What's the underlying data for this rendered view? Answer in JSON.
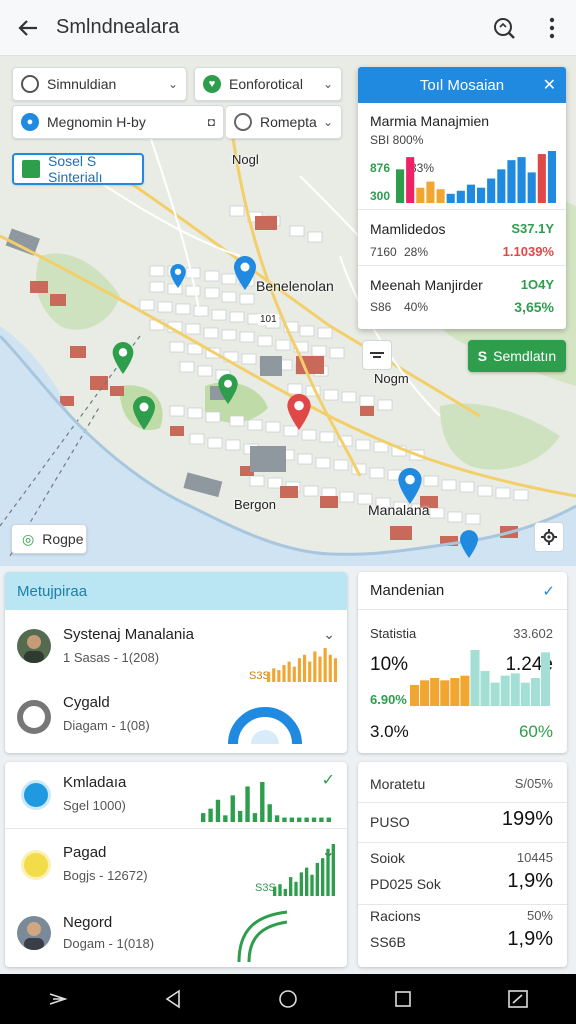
{
  "app": {
    "title": "Smlndnealara"
  },
  "map": {
    "filters": [
      {
        "label": "Simnuldian",
        "icon": "globe-icon"
      },
      {
        "label": "Eonforotical",
        "icon": "heart-icon"
      },
      {
        "label": "Megnomin H-by",
        "icon": "pin-icon"
      },
      {
        "label": "Romepta",
        "icon": "circle-icon"
      }
    ],
    "sidebar_chip": "Sosel S Sinterialı",
    "labels": {
      "nogl": "Nogl",
      "central": "Benelenolan",
      "nogm": "Nogm",
      "bergon": "Bergon",
      "manalana": "Manalana",
      "poi": "101"
    },
    "page_chip": "Rogpe",
    "action_button": "Semdlatın",
    "action_icon": "S"
  },
  "overlay": {
    "title": "Toıl Mosaian",
    "sections": [
      {
        "title": "Marmia Manajmien",
        "l1": "SBI 800%",
        "l2": "876",
        "l2b": "33%",
        "l3": "300",
        "bars": [
          {
            "v": 22,
            "c": "#2e9e4c"
          },
          {
            "v": 30,
            "c": "#e26"
          },
          {
            "v": 10,
            "c": "#f0a630"
          },
          {
            "v": 14,
            "c": "#f0a630"
          },
          {
            "v": 9,
            "c": "#f0a630"
          },
          {
            "v": 6,
            "c": "#1f8ae0"
          },
          {
            "v": 8,
            "c": "#1f8ae0"
          },
          {
            "v": 12,
            "c": "#1f8ae0"
          },
          {
            "v": 10,
            "c": "#1f8ae0"
          },
          {
            "v": 16,
            "c": "#1f8ae0"
          },
          {
            "v": 22,
            "c": "#1f8ae0"
          },
          {
            "v": 28,
            "c": "#1f8ae0"
          },
          {
            "v": 30,
            "c": "#1f8ae0"
          },
          {
            "v": 20,
            "c": "#1f8ae0"
          },
          {
            "v": 32,
            "c": "#e04848"
          },
          {
            "v": 34,
            "c": "#1f8ae0"
          }
        ]
      },
      {
        "title": "Mamlidedos",
        "l1": "7160",
        "l1b": "28%",
        "n1": "S37.1Y",
        "n2": "1.1039%"
      },
      {
        "title": "Meenah Manjirder",
        "l1": "S86",
        "l1b": "40%",
        "n1": "1O4Y",
        "n2": "3,65%"
      }
    ]
  },
  "card_main": {
    "title": "Metujpiraa",
    "rows": [
      {
        "title": "Systenaj Manalania",
        "sub": "1 Sasas - 1(208)",
        "icon": "user-avatar-icon"
      },
      {
        "title": "Cygald",
        "sub": "Diagam - 1(08)",
        "icon": "ring-icon"
      }
    ],
    "spark_label": "S3S",
    "spark": [
      6,
      8,
      7,
      10,
      12,
      9,
      14,
      16,
      12,
      18,
      15,
      20,
      16,
      14
    ]
  },
  "card_stats": {
    "title": "Mandenian",
    "label": "Statistia",
    "value": "33.602",
    "big_left": "10%",
    "big_right": "1.24e",
    "small_left": "6.90%",
    "foot_left": "3.0%",
    "foot_right": "60%",
    "bars": [
      {
        "v": 18,
        "c": "#f0a630"
      },
      {
        "v": 22,
        "c": "#f0a630"
      },
      {
        "v": 24,
        "c": "#f0a630"
      },
      {
        "v": 22,
        "c": "#f0a630"
      },
      {
        "v": 24,
        "c": "#f0a630"
      },
      {
        "v": 26,
        "c": "#f0a630"
      },
      {
        "v": 48,
        "c": "#a3dfd4"
      },
      {
        "v": 30,
        "c": "#a3dfd4"
      },
      {
        "v": 20,
        "c": "#a3dfd4"
      },
      {
        "v": 26,
        "c": "#a3dfd4"
      },
      {
        "v": 28,
        "c": "#a3dfd4"
      },
      {
        "v": 20,
        "c": "#a3dfd4"
      },
      {
        "v": 24,
        "c": "#a3dfd4"
      },
      {
        "v": 46,
        "c": "#a3dfd4"
      }
    ]
  },
  "card_list": {
    "rows": [
      {
        "title": "Kmladaıa",
        "sub": "Sgel 1000)",
        "icon": "refresh-icon"
      },
      {
        "title": "Pagad",
        "sub": "Bogjs - 12672)",
        "icon": "sun-icon"
      },
      {
        "title": "Negord",
        "sub": "Dogam - 1(018)",
        "icon": "user-avatar-icon"
      }
    ],
    "spark1": [
      4,
      6,
      10,
      3,
      12,
      5,
      16,
      4,
      18,
      8,
      3,
      2,
      2,
      2,
      2,
      2,
      2,
      2
    ],
    "spark2_label": "S3S",
    "spark2": [
      4,
      5,
      3,
      8,
      6,
      10,
      12,
      9,
      14,
      16,
      20,
      22
    ]
  },
  "card_metrics": {
    "title": "Moratetu",
    "title_value": "S/05%",
    "rows": [
      {
        "label": "PUSO",
        "value": "199%",
        "small": ""
      },
      {
        "label": "Soiok",
        "small": "10445",
        "label2": "PD025 Sok",
        "value": "1,9%"
      },
      {
        "label": "Racions",
        "small": "50%",
        "label2": "SS6B",
        "value": "1,9%"
      }
    ]
  },
  "colors": {
    "accent": "#1f8ae0",
    "green": "#2e9e4c",
    "orange": "#f0a630",
    "cyan_head": "#b9e6f2",
    "red": "#e04848"
  }
}
